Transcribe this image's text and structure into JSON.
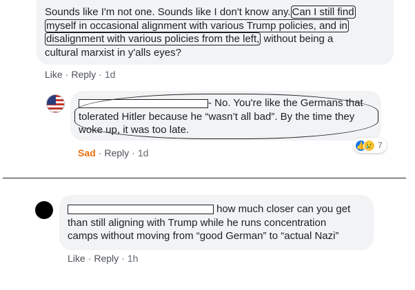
{
  "comments": [
    {
      "text_plain": "Sounds like I'm not one. Sounds like I don't know any.",
      "line1_marked": "Can I still find",
      "line2_marked": "myself in occasional alignment with various Trump policies, and in",
      "line3_marked": "disalignment with various policies from the left,",
      "line3_rest": "without being a",
      "line4": "cultural marxist in y'alls eyes?",
      "actions": {
        "like": "Like",
        "reply": "Reply",
        "time": "1d"
      }
    },
    {
      "text_line1": "- No. You're like the Germans that",
      "text_line2": "tolerated Hitler because he “wasn’t all bad”. By the time they",
      "text_line3": "woke up, it was too late.",
      "actions": {
        "reaction": "Sad",
        "reply": "Reply",
        "time": "1d"
      },
      "reactions": {
        "count": "7"
      }
    },
    {
      "text_line1": "how much closer can you get",
      "text_line2": "than still aligning with Trump while he runs concentration",
      "text_line3": "camps without moving from “good German” to “actual Nazi”",
      "actions": {
        "like": "Like",
        "reply": "Reply",
        "time": "1h"
      }
    }
  ],
  "separator": "·",
  "colors": {
    "bubble": "#f2f3f5",
    "sad_reaction": "#e9710f",
    "like_blue": "#1877f2",
    "sad_yellow": "#f7c744"
  },
  "icons": [
    "flag-avatar",
    "black-avatar",
    "like-reaction-icon",
    "sad-reaction-icon"
  ]
}
